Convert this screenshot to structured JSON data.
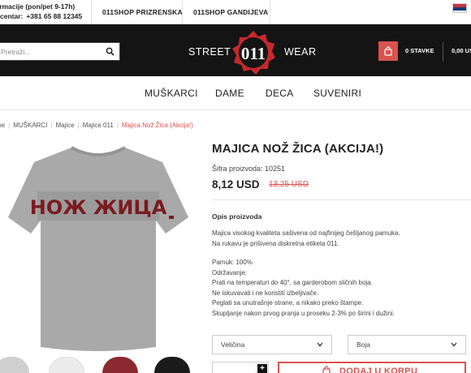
{
  "topbar": {
    "info_line1": "ormacije (pon/pet 9-17h)",
    "info_line2_label": "centar:",
    "info_line2_phone": "+381 65 88 12345",
    "shop1": "011SHOP PRIZRENSKA",
    "shop2": "011SHOP GANDIJEVA"
  },
  "header": {
    "search_placeholder": "Pretraži...",
    "brand_left": "STREET",
    "brand_right": "WEAR",
    "logo_text": "011",
    "cart_items": "0 STAVKE",
    "cart_total": "0,00 US"
  },
  "nav": {
    "items": [
      "MUŠKARCI",
      "DAME",
      "DECA",
      "SUVENIRI"
    ]
  },
  "breadcrumb": {
    "items": [
      "me",
      "MUŠKARCI",
      "Majice",
      "Majice 011"
    ],
    "current": "Majica Nož Žica (Akcija!)"
  },
  "product": {
    "title": "MAJICA NOŽ ŽICA (AKCIJA!)",
    "sku_label": "Šifra proizvoda: 10251",
    "price": "8,12 USD",
    "old_price": "13,25 USD",
    "print_text": "НОЖ ЖИЦА",
    "desc_heading": "Opis proizvoda",
    "desc_lines_a": [
      "Majica visokog kvaliteta sašivena od najfinijeg češljanog pamuka.",
      "Na rukavu je prišivena diskretna etiketa 011."
    ],
    "desc_lines_b": [
      "Pamuk: 100%",
      "Održavanje:",
      "Prati na temperaturi do 40°, sa garderobom sličnih boja.",
      "Ne iskuvavati i ne koristiti izbeljivače.",
      "Peglati sa unutrašnje strane, a nikako preko štampe.",
      "Skupljanje nakon prvog pranja u proseku 2-3% po širini i dužini."
    ],
    "size_select": "Veličina",
    "color_select": "Boja",
    "add_to_cart": "DODAJ U KORPU",
    "plus_label": "+"
  },
  "colors": {
    "accent": "#d9534f",
    "header_bg": "#141414",
    "shirt_gray": "#a9a9a9",
    "print_red": "#7a1b1f"
  }
}
